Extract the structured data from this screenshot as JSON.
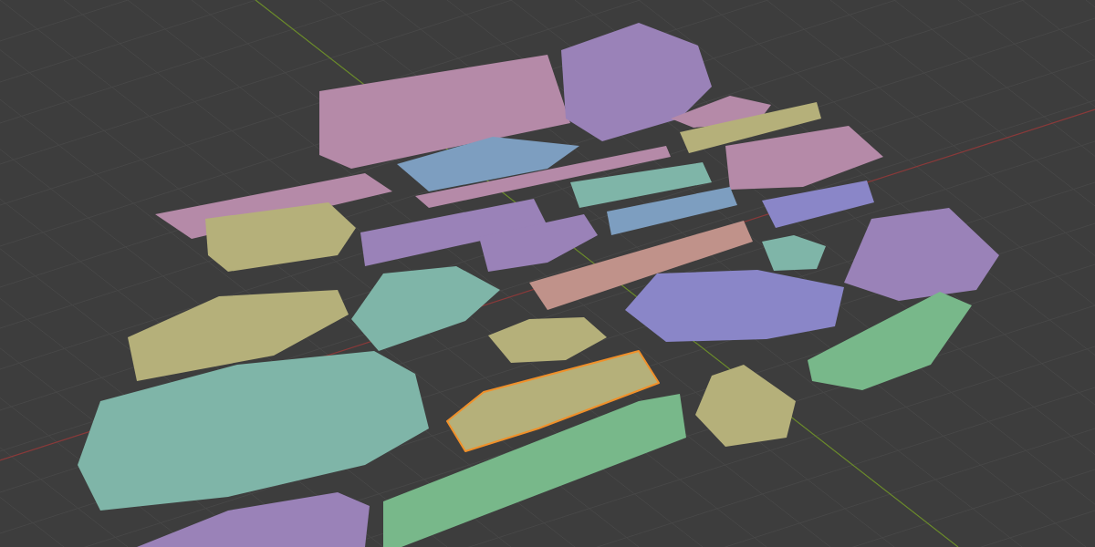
{
  "viewport": {
    "objects": [
      {
        "color": "#b58aa8",
        "selected": false
      },
      {
        "color": "#9a82b8",
        "selected": false
      },
      {
        "color": "#b58aa8",
        "selected": false
      },
      {
        "color": "#b5b07a",
        "selected": false
      },
      {
        "color": "#7d9ec0",
        "selected": false
      },
      {
        "color": "#b58aa8",
        "selected": false
      },
      {
        "color": "#b58aa8",
        "selected": false
      },
      {
        "color": "#b58aa8",
        "selected": false
      },
      {
        "color": "#7fb5a8",
        "selected": false
      },
      {
        "color": "#b5b07a",
        "selected": false
      },
      {
        "color": "#9a82b8",
        "selected": false
      },
      {
        "color": "#9a82b8",
        "selected": false
      },
      {
        "color": "#7d9ec0",
        "selected": false
      },
      {
        "color": "#8a86c8",
        "selected": false
      },
      {
        "color": "#7fb5a8",
        "selected": false
      },
      {
        "color": "#9a82b8",
        "selected": false
      },
      {
        "color": "#c0928a",
        "selected": false
      },
      {
        "color": "#b5b07a",
        "selected": false
      },
      {
        "color": "#7fb5a8",
        "selected": false
      },
      {
        "color": "#8a86c8",
        "selected": false
      },
      {
        "color": "#b5b07a",
        "selected": false
      },
      {
        "color": "#78b88a",
        "selected": false
      },
      {
        "color": "#7fb5a8",
        "selected": false
      },
      {
        "color": "#b5b07a",
        "selected": true
      },
      {
        "color": "#b5b07a",
        "selected": false
      },
      {
        "color": "#78b88a",
        "selected": false
      },
      {
        "color": "#9a82b8",
        "selected": false
      }
    ]
  }
}
